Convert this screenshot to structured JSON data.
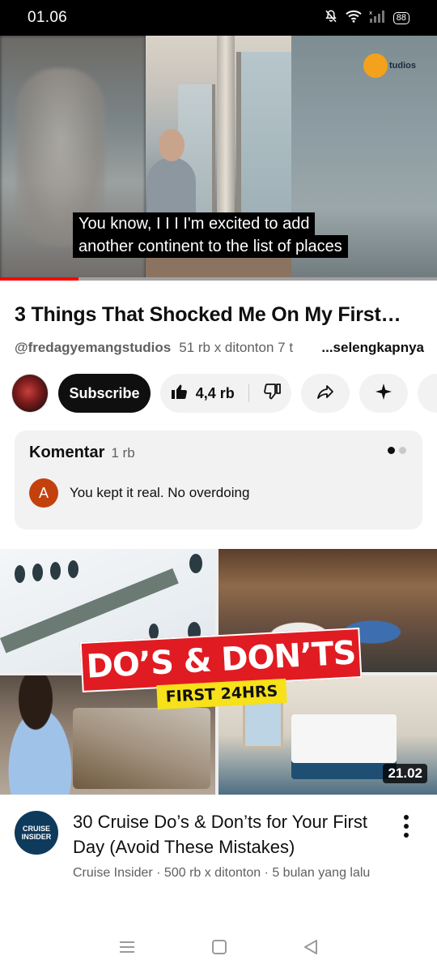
{
  "status_bar": {
    "time": "01.06",
    "battery": "88"
  },
  "player": {
    "logo_text": "tudios",
    "caption_line1": "You know, I I I I'm excited to add",
    "caption_line2": "another continent to the list of places",
    "progress": 0.18
  },
  "video": {
    "title": "3 Things That Shocked Me On My First…",
    "channel": "@fredagyemangstudios",
    "views": "51 rb x ditonton  7 t",
    "more_label": "...selengkapnya"
  },
  "actions": {
    "subscribe_label": "Subscribe",
    "like_count": "4,4 rb"
  },
  "comments": {
    "title": "Komentar",
    "count": "1 rb",
    "first_comment_avatar": "A",
    "first_comment_text": "You kept it real. No overdoing"
  },
  "next_video": {
    "thumb_banner": "DO’S & DON’TS",
    "thumb_subbanner": "FIRST 24HRS",
    "duration": "21.02",
    "channel_avatar_text": "CRUISE INSIDER",
    "title": "30 Cruise Do’s & Don’ts for Your First Day (Avoid These Mistakes)",
    "meta": "Cruise Insider · 500 rb x ditonton · 5 bulan yang lalu"
  },
  "colors": {
    "accent_red": "#ff0000",
    "subscribe_bg": "#0f0f0f",
    "pill_bg": "#f2f2f2",
    "comment_avatar": "#c2410c"
  },
  "icons": [
    "mute-icon",
    "wifi-icon",
    "signal-icon",
    "battery-icon",
    "like-icon",
    "dislike-icon",
    "share-icon",
    "remix-icon",
    "more-vert-icon",
    "nav-recents-icon",
    "nav-home-icon",
    "nav-back-icon"
  ]
}
